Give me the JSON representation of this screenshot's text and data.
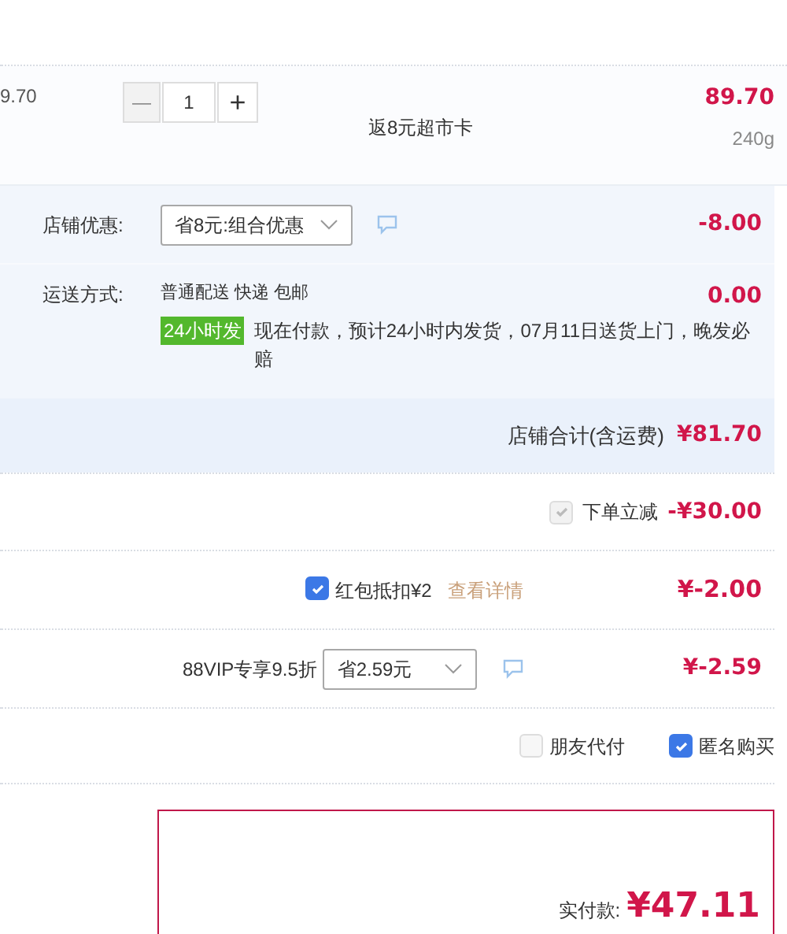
{
  "item": {
    "unit_price": "9.70",
    "quantity": "1",
    "decrement": "—",
    "increment": "+",
    "promo": "返8元超市卡",
    "subtotal": "89.70",
    "weight": "240g"
  },
  "shop": {
    "discount": {
      "label": "店铺优惠:",
      "option": "省8元:组合优惠",
      "amount": "-8.00"
    },
    "shipping": {
      "label": "运送方式:",
      "method": "普通配送 快递 包邮",
      "amount": "0.00",
      "badge": "24小时发",
      "note": "现在付款，预计24小时内发货，07月11日送货上门，晚发必赔"
    },
    "total": {
      "label": "店铺合计(含运费)",
      "amount": "¥81.70"
    }
  },
  "instant_discount": {
    "label": "下单立减",
    "checked": true,
    "disabled": true,
    "amount": "-¥30.00"
  },
  "red_packet": {
    "label": "红包抵扣¥2",
    "checked": true,
    "link": "查看详情",
    "amount": "¥-2.00"
  },
  "vip": {
    "label": "88VIP专享9.5折",
    "option": "省2.59元",
    "amount": "¥-2.59"
  },
  "options": [
    {
      "label": "朋友代付",
      "checked": false
    },
    {
      "label": "匿名购买",
      "checked": true
    }
  ],
  "payment": {
    "label": "实付款:",
    "amount": "¥47.11"
  }
}
